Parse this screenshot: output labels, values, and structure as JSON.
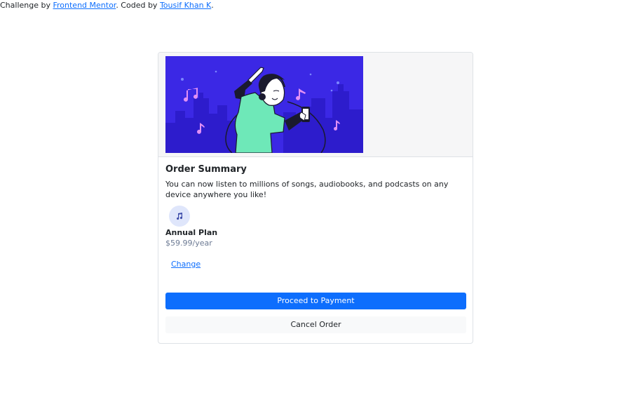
{
  "attribution": {
    "prefix": "Challenge by ",
    "challenge_link": "Frontend Mentor",
    "middle": ". Coded by ",
    "author_link": "Tousif Khan K",
    "suffix": "."
  },
  "hero": {
    "background_color": "#3b28e5",
    "icon": "illustration-dancing-person-with-headphones"
  },
  "order": {
    "title": "Order Summary",
    "description": "You can now listen to millions of songs, audiobooks, and podcasts on any device anywhere you like!",
    "plan_icon": "music-note-icon",
    "plan_name": "Annual Plan",
    "plan_price": "$59.99/year",
    "change_label": "Change"
  },
  "actions": {
    "proceed_label": "Proceed to Payment",
    "cancel_label": "Cancel Order"
  },
  "colors": {
    "primary": "#0d6efd",
    "secondary_bg": "#f8f9fa",
    "plan_icon_bg": "#dfe6fb"
  }
}
